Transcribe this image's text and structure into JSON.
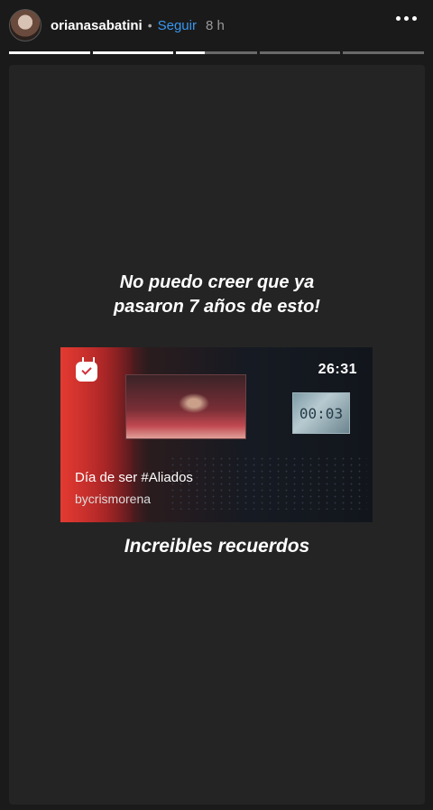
{
  "header": {
    "username": "orianasabatini",
    "separator": "•",
    "follow_label": "Seguir",
    "time_ago": "8 h"
  },
  "progress": {
    "segments": [
      1,
      1,
      0.35,
      0,
      0
    ]
  },
  "story": {
    "caption_top": "No puedo creer que ya pasaron 7 años de esto!",
    "caption_bottom": "Increibles recuerdos",
    "video": {
      "duration": "26:31",
      "title": "Día de ser #Aliados",
      "author": "bycrismorena",
      "overlay_screen_text": "00:03"
    }
  },
  "icons": {
    "more": "more-horizontal-icon",
    "igtv": "igtv-icon"
  },
  "colors": {
    "follow": "#3897f0",
    "background": "#1a1a1a",
    "story_bg": "#242424"
  }
}
